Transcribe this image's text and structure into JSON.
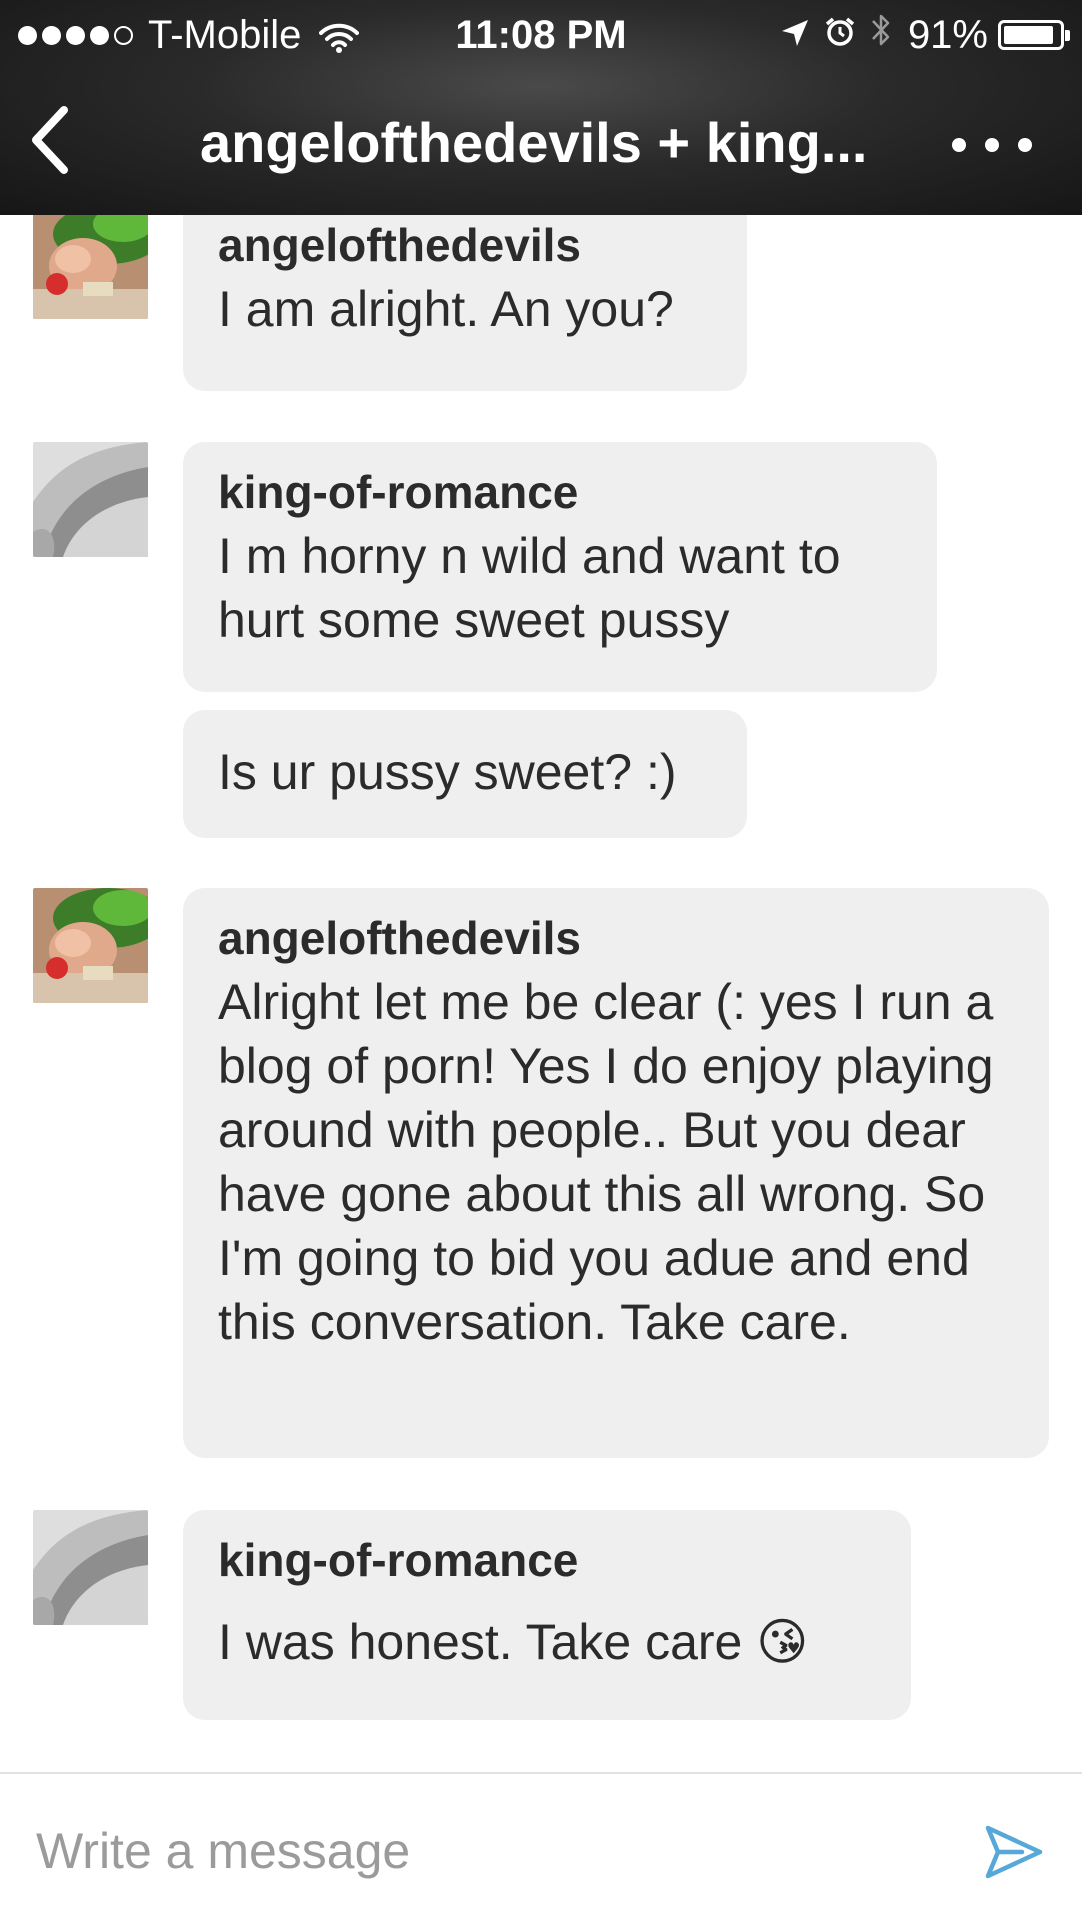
{
  "status_bar": {
    "carrier": "T-Mobile",
    "time": "11:08 PM",
    "battery": "91%",
    "signal_bars_filled": 4,
    "signal_bars_total": 5,
    "battery_level": 0.91
  },
  "nav": {
    "title": "angelofthedevils + king..."
  },
  "messages": [
    {
      "sender": "angelofthedevils",
      "text": "I am alright. An you?"
    },
    {
      "sender": "king-of-romance",
      "text": "I m horny n wild and want to hurt some sweet pussy"
    },
    {
      "sender": "",
      "text": "Is ur pussy sweet? :)"
    },
    {
      "sender": "angelofthedevils",
      "text": "Alright let me be clear (: yes I run a blog of porn! Yes I do enjoy playing around with people.. But you dear have gone about this all wrong. So I'm going to bid you adue and end this conversation. Take care."
    },
    {
      "sender": "king-of-romance",
      "text": "I was honest. Take care 😘"
    }
  ],
  "compose": {
    "placeholder": "Write a message"
  },
  "colors": {
    "bubble": "#efefef",
    "send_icon": "#56a8d8",
    "placeholder": "#9b9b9b",
    "nav_background": "#1e1e1e"
  },
  "icons": {
    "back": "chevron-left-icon",
    "more": "more-dots-icon",
    "send": "send-icon",
    "wifi": "wifi-icon",
    "location": "location-arrow-icon",
    "alarm": "alarm-clock-icon",
    "bluetooth": "bluetooth-icon",
    "battery": "battery-icon"
  }
}
